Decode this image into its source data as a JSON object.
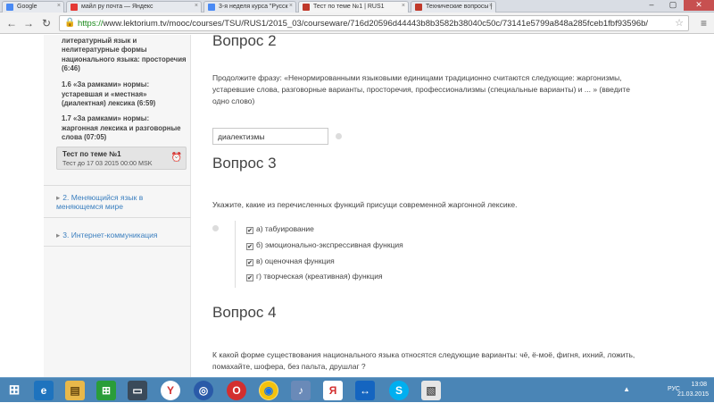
{
  "browser": {
    "tabs": [
      {
        "label": "Google",
        "icon": "google-icon",
        "color": "#4a8af4"
      },
      {
        "label": "майл ру почта — Яндекс",
        "icon": "yandex-icon",
        "color": "#e53935"
      },
      {
        "label": "3-я неделя курса \"Русск",
        "icon": "doc-icon",
        "color": "#4a8af4"
      },
      {
        "label": "Тест по теме №1 | RUS1",
        "icon": "lektorium-icon",
        "color": "#c0392b"
      },
      {
        "label": "Технические вопросы |",
        "icon": "lektorium-icon",
        "color": "#c0392b"
      }
    ],
    "active_tab": 3,
    "url_scheme": "https://",
    "url_rest": "www.lektorium.tv/mooc/courses/TSU/RUS1/2015_03/courseware/716d20596d44443b8b3582b38040c50c/73141e5799a848a285fceb1fbf93596b/"
  },
  "sidebar": {
    "lessons": [
      {
        "label": "1.5 «За рамками» нормы: литературный язык и нелитературные формы национального языка: просторечия (6:46)"
      },
      {
        "label": "1.6 «За рамками» нормы: устаревшая и «местная» (диалектная) лексика (6:59)"
      },
      {
        "label": "1.7 «За рамками» нормы: жаргонная лексика и разговорные слова (07:05)"
      }
    ],
    "test": {
      "title": "Тест по теме №1",
      "due": "Тест до 17 03 2015 00:00 MSK"
    },
    "sections": [
      {
        "label": "2. Меняющийся язык в меняющемся мире"
      },
      {
        "label": "3. Интернет-коммуникация"
      }
    ]
  },
  "questions": [
    {
      "title": "Вопрос 2",
      "text": "Продолжите фразу: «Ненормированными языковыми единицами традиционно считаются следующие: жаргонизмы, устаревшие слова, разговорные варианты, просторечия, профессионализмы (специальные варианты) и ... » (введите одно слово)",
      "answer": "диалектизмы"
    },
    {
      "title": "Вопрос 3",
      "text": "Укажите, какие из перечисленных функций присущи современной жаргонной лексике.",
      "options": [
        {
          "label": "а) табуирование",
          "checked": true
        },
        {
          "label": "б) эмоционально-экспрессивная функция",
          "checked": true
        },
        {
          "label": "в) оценочная функция",
          "checked": true
        },
        {
          "label": "г) творческая (креативная) функция",
          "checked": true
        }
      ]
    },
    {
      "title": "Вопрос 4",
      "text": "К какой форме существования национального языка относятся следующие варианты: чё, ё-моё, фигня, ихний, ложить, помахайте, шофера, без пальта, друшлаг ?"
    }
  ],
  "taskbar": {
    "apps": [
      {
        "icon": "ie-icon",
        "color": "#1e73be",
        "glyph": "e"
      },
      {
        "icon": "explorer-icon",
        "color": "#e8b84a",
        "glyph": "▤"
      },
      {
        "icon": "store-icon",
        "color": "#2a9d3a",
        "glyph": "⊞"
      },
      {
        "icon": "monitor-icon",
        "color": "#3a4a5a",
        "glyph": "▭"
      },
      {
        "icon": "yandex-browser-icon",
        "color": "#ffffff",
        "glyph": "Y"
      },
      {
        "icon": "compass-icon",
        "color": "#2a5aa8",
        "glyph": "◎"
      },
      {
        "icon": "opera-icon",
        "color": "#d32f2f",
        "glyph": "O"
      },
      {
        "icon": "chrome-icon",
        "color": "#f4c20d",
        "glyph": "◉"
      },
      {
        "icon": "audio-icon",
        "color": "#6a8ab8",
        "glyph": "♪"
      },
      {
        "icon": "yandex-icon",
        "color": "#ffffff",
        "glyph": "Я"
      },
      {
        "icon": "teamviewer-icon",
        "color": "#1565c0",
        "glyph": "↔"
      },
      {
        "icon": "skype-icon",
        "color": "#00aff0",
        "glyph": "S"
      },
      {
        "icon": "documents-icon",
        "color": "#e6e6e6",
        "glyph": "▧"
      }
    ],
    "language": "РУС",
    "time": "13:08",
    "date": "21.03.2015"
  }
}
